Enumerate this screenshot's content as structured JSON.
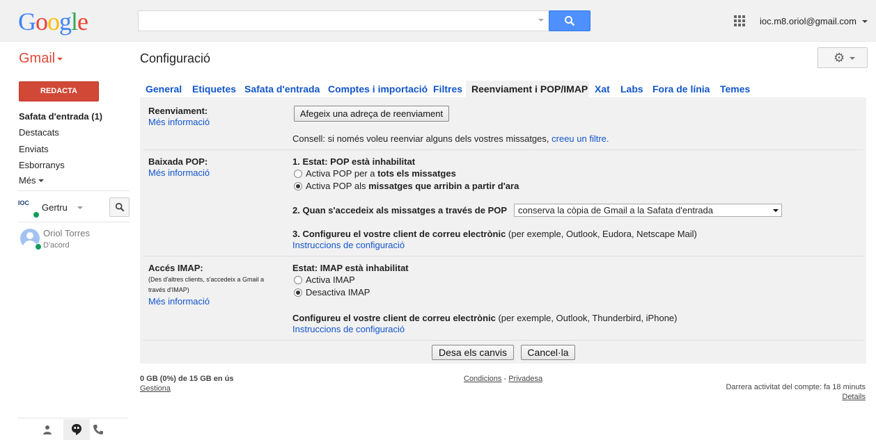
{
  "header": {
    "logo": "Google",
    "search_placeholder": "",
    "account_email": "ioc.m8.oriol@gmail.com"
  },
  "app": {
    "name": "Gmail",
    "page_title": "Configuració"
  },
  "sidebar": {
    "compose_label": "REDACTA",
    "items": [
      {
        "label": "Safata d'entrada (1)"
      },
      {
        "label": "Destacats"
      },
      {
        "label": "Enviats"
      },
      {
        "label": "Esborranys"
      },
      {
        "label": "Més"
      }
    ],
    "hangouts_user": "Gertru",
    "hangouts_logo": "IOC",
    "contact": {
      "name": "Oriol Torres",
      "status": "D'acord"
    }
  },
  "tabs": [
    {
      "label": "General"
    },
    {
      "label": "Etiquetes"
    },
    {
      "label": "Safata d'entrada"
    },
    {
      "label": "Comptes i importació"
    },
    {
      "label": "Filtres"
    },
    {
      "label": "Reenviament i POP/IMAP",
      "active": true
    },
    {
      "label": "Xat"
    },
    {
      "label": "Labs"
    },
    {
      "label": "Fora de línia"
    },
    {
      "label": "Temes"
    }
  ],
  "forwarding": {
    "label": "Reenviament:",
    "more_info": "Més informació",
    "add_button": "Afegeix una adreça de reenviament",
    "tip_text": "Consell: si només voleu reenviar alguns dels vostres missatges,",
    "tip_link": "creeu un filtre."
  },
  "pop": {
    "label": "Baixada POP:",
    "more_info": "Més informació",
    "status": "1. Estat: POP està inhabilitat",
    "option1_prefix": "Activa POP per a ",
    "option1_bold": "tots els missatges",
    "option2_prefix": "Activa POP als ",
    "option2_bold": "missatges que arribin a partir d'ara",
    "step2_label": "2. Quan s'accedeix als missatges a través de POP",
    "step2_value": "conserva la còpia de Gmail a la Safata d'entrada",
    "step3_bold": "3. Configureu el vostre client de correu electrònic",
    "step3_rest": " (per exemple, Outlook, Eudora, Netscape Mail)",
    "instructions": "Instruccions de configuració",
    "selected_option": 2
  },
  "imap": {
    "label": "Accés IMAP:",
    "note": "(Des d'altres clients, s'accedeix a Gmail a través d'IMAP)",
    "more_info": "Més informació",
    "status": "Estat: IMAP està inhabilitat",
    "option1": "Activa IMAP",
    "option2": "Desactiva IMAP",
    "configure_bold": "Configureu el vostre client de correu electrònic",
    "configure_rest": " (per exemple, Outlook, Thunderbird, iPhone)",
    "instructions": "Instruccions de configuració",
    "selected_option": 2
  },
  "actions": {
    "save": "Desa els canvis",
    "cancel": "Cancel·la"
  },
  "footer": {
    "storage": "0 GB (0%) de 15 GB en ús",
    "manage": "Gestiona",
    "terms": "Condicions",
    "separator": " - ",
    "privacy": "Privadesa",
    "last_activity": "Darrera activitat del compte: fa 18 minuts",
    "details": "Details"
  },
  "colors": {
    "compose": "#d14836",
    "gmail_red": "#dd4b39",
    "link": "#1155cc",
    "search_button": "#4d90fe"
  }
}
